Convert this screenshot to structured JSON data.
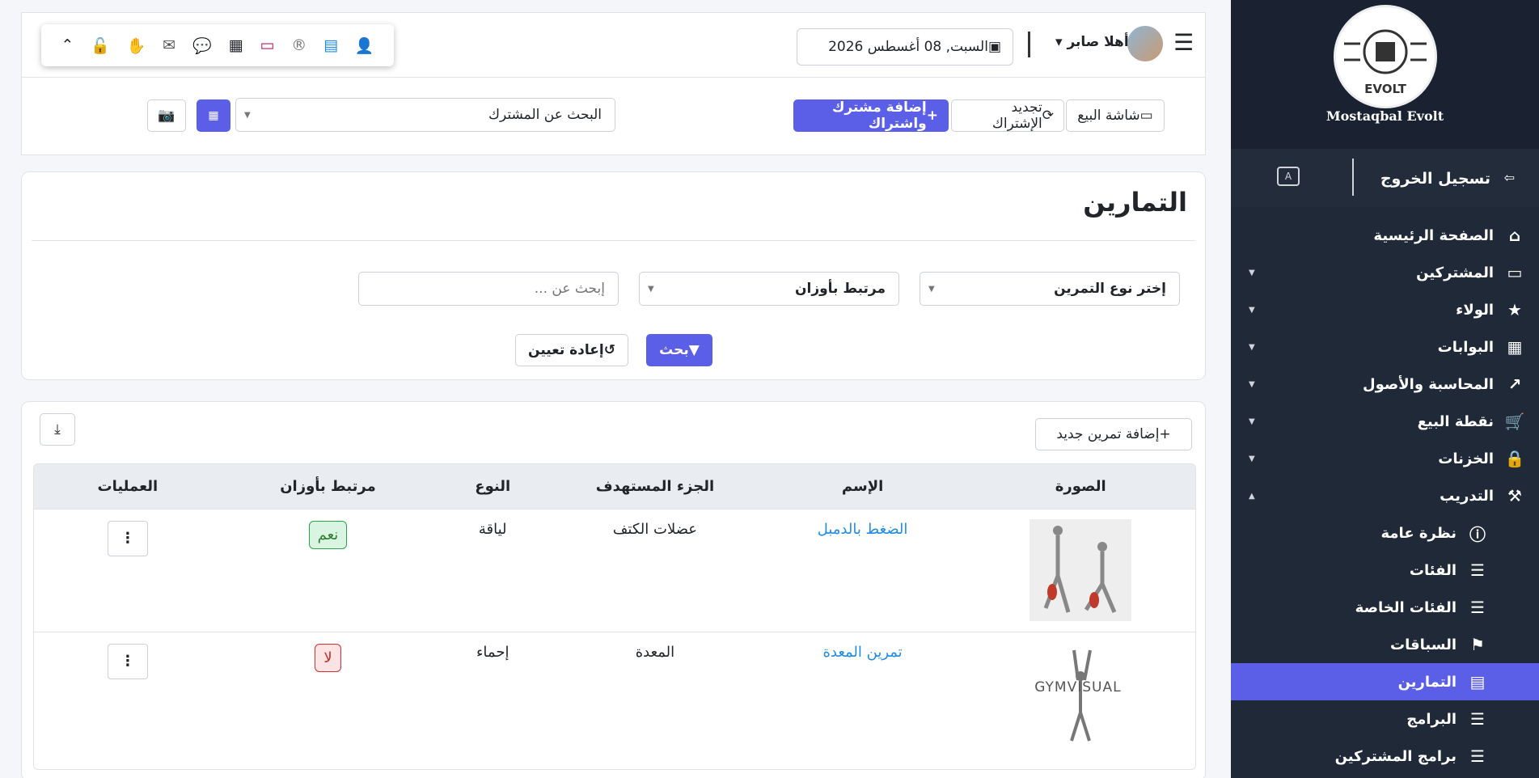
{
  "topbar": {
    "date": "السبت, 08 أغسطس 2026",
    "greeting": "أهلا صابر",
    "pos_button": "شاشة البيع",
    "renew_button": "تجديد الإشتراك",
    "add_button": "إضافة مشترك واشتراك",
    "search_select": "البحث عن المشترك"
  },
  "sidebar": {
    "brand": "Mostaqbal Evolt",
    "logo_text": "EVOLT",
    "logout": "تسجيل الخروج",
    "items": [
      {
        "label": "الصفحة الرئيسية",
        "icon": "home-icon"
      },
      {
        "label": "المشتركين",
        "icon": "laptop-icon"
      },
      {
        "label": "الولاء",
        "icon": "star-icon"
      },
      {
        "label": "البوابات",
        "icon": "building-icon"
      },
      {
        "label": "المحاسبة والأصول",
        "icon": "chart-line-icon"
      },
      {
        "label": "نقطة البيع",
        "icon": "cart-icon"
      },
      {
        "label": "الخزنات",
        "icon": "lock-icon"
      },
      {
        "label": "التدريب",
        "icon": "magic-wand-icon"
      },
      {
        "label": "نظرة عامة",
        "icon": "info-icon"
      },
      {
        "label": "الفئات",
        "icon": "list-icon"
      },
      {
        "label": "الفئات الخاصة",
        "icon": "list-icon"
      },
      {
        "label": "السباقات",
        "icon": "flag-icon"
      },
      {
        "label": "التمارين",
        "icon": "calendar-icon"
      },
      {
        "label": "البرامج",
        "icon": "list-icon"
      },
      {
        "label": "برامج المشتركين",
        "icon": "list-icon"
      }
    ]
  },
  "filters": {
    "title": "التمارين",
    "type_select": "إختر نوع التمرين",
    "weights_select": "مرتبط بأوزان",
    "search_placeholder": "إبحث عن ...",
    "search_button": "بحث",
    "reset_button": "إعادة تعيين"
  },
  "list": {
    "add_button": "إضافة تمرين جديد",
    "columns": [
      "الصورة",
      "الإسم",
      "الجزء المستهدف",
      "النوع",
      "مرتبط بأوزان",
      "العمليات"
    ],
    "rows": [
      {
        "name": "الضغط بالدمبل",
        "target": "عضلات الكتف",
        "type": "لياقة",
        "weights": "نعم"
      },
      {
        "name": "تمرين المعدة",
        "target": "المعدة",
        "type": "إحماء",
        "weights": "لا",
        "image_caption": "GYMVISUAL"
      }
    ]
  },
  "colors": {
    "primary": "#5b5fe8",
    "sidebar": "#1f2937",
    "link": "#1f8ce6"
  }
}
